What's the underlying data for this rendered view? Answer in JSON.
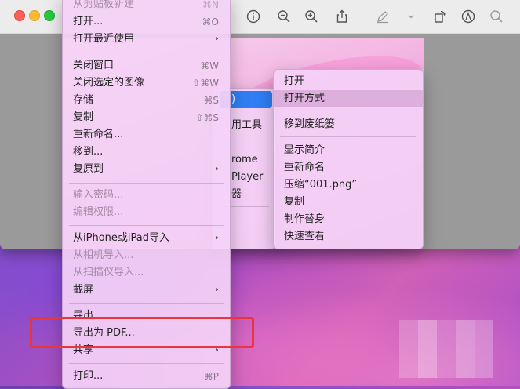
{
  "toolbar": {
    "icons": [
      "info-icon",
      "zoom-out-icon",
      "zoom-in-icon",
      "share-icon",
      "markup-pen-icon",
      "chevron-down-icon",
      "rotate-icon",
      "annotate-icon",
      "search-icon"
    ]
  },
  "file_menu": {
    "items": [
      {
        "label": "从剪贴板新建",
        "shortcut": "⌘N",
        "disabled": true
      },
      {
        "label": "打开...",
        "shortcut": "⌘O"
      },
      {
        "label": "打开最近使用",
        "submenu": true
      },
      {
        "label": "关闭窗口",
        "shortcut": "⌘W"
      },
      {
        "label": "关闭选定的图像",
        "shortcut": "⇧⌘W"
      },
      {
        "label": "存储",
        "shortcut": "⌘S"
      },
      {
        "label": "复制",
        "shortcut": "⇧⌘S"
      },
      {
        "label": "重新命名..."
      },
      {
        "label": "移到..."
      },
      {
        "label": "复原到",
        "submenu": true
      },
      {
        "label": "输入密码...",
        "disabled": true
      },
      {
        "label": "编辑权限...",
        "disabled": true
      },
      {
        "label": "从iPhone或iPad导入",
        "submenu": true
      },
      {
        "label": "从相机导入...",
        "disabled": true
      },
      {
        "label": "从扫描仪导入...",
        "disabled": true
      },
      {
        "label": "截屏",
        "submenu": true
      },
      {
        "label": "导出..."
      },
      {
        "label": "导出为 PDF..."
      },
      {
        "label": "共享",
        "submenu": true
      },
      {
        "label": "打印...",
        "shortcut": "⌘P"
      }
    ]
  },
  "open_with_submenu": {
    "highlighted": ")",
    "items": [
      "用工具",
      "rome",
      "Player",
      "器"
    ]
  },
  "context_menu": {
    "items": [
      "打开",
      "打开方式",
      "移到废纸篓",
      "显示简介",
      "重新命名",
      "压缩“001.png”",
      "复制",
      "制作替身",
      "快速查看"
    ]
  },
  "colors": {
    "highlight": "#2f7ef3",
    "annotation_box": "#e8363a",
    "traffic_red": "#fe5f57",
    "traffic_yellow": "#febc2e",
    "traffic_green": "#28c840"
  }
}
